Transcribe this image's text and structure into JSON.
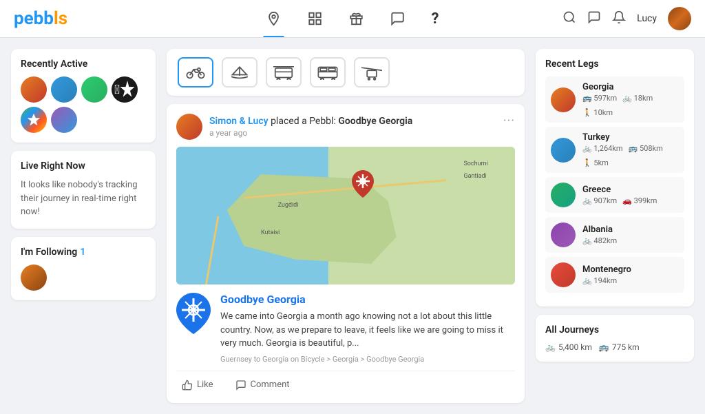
{
  "header": {
    "logo": "pebbls",
    "nav": [
      {
        "id": "location",
        "label": "Location",
        "active": true
      },
      {
        "id": "grid",
        "label": "Grid"
      },
      {
        "id": "gift",
        "label": "Gift"
      },
      {
        "id": "chat",
        "label": "Chat"
      },
      {
        "id": "help",
        "label": "Help"
      }
    ],
    "user": "Lucy"
  },
  "recently_active": {
    "title": "Recently Active",
    "users": [
      "User 1",
      "User 2",
      "User 3",
      "Apple",
      "Google Play",
      "User 6"
    ]
  },
  "live_right_now": {
    "title": "Live Right Now",
    "text": "It looks like nobody's tracking their journey in real-time right now!"
  },
  "im_following": {
    "title": "I'm Following",
    "count": "1"
  },
  "filter_bar": {
    "options": [
      "bike",
      "boat",
      "bus/tram",
      "bus",
      "cable-car"
    ]
  },
  "post": {
    "user": "Simon & Lucy",
    "action": "placed a Pebbl:",
    "title": "Goodbye Georgia",
    "time": "a year ago",
    "description": "We came into Georgia a month ago knowing not a lot about this little country. Now, as we prepare to leave, it feels like we are going to miss it very much. Georgia is beautiful, p...",
    "breadcrumb": "Guernsey to Georgia on Bicycle > Georgia > Goodbye Georgia",
    "like": "Like",
    "comment": "Comment"
  },
  "recent_legs": {
    "title": "Recent Legs",
    "items": [
      {
        "name": "Georgia",
        "stats": [
          {
            "type": "bus",
            "value": "597km"
          },
          {
            "type": "bike",
            "value": "18km"
          },
          {
            "type": "walk",
            "value": "10km"
          }
        ]
      },
      {
        "name": "Turkey",
        "stats": [
          {
            "type": "bike",
            "value": "1,264km"
          },
          {
            "type": "bus",
            "value": "508km"
          },
          {
            "type": "walk",
            "value": "5km"
          }
        ]
      },
      {
        "name": "Greece",
        "stats": [
          {
            "type": "bike",
            "value": "907km"
          },
          {
            "type": "car",
            "value": "399km"
          }
        ]
      },
      {
        "name": "Albania",
        "stats": [
          {
            "type": "bike",
            "value": "482km"
          }
        ]
      },
      {
        "name": "Montenegro",
        "stats": [
          {
            "type": "bike",
            "value": "194km"
          }
        ]
      }
    ]
  },
  "all_journeys": {
    "title": "All Journeys",
    "stats": [
      {
        "type": "bike",
        "value": "5,400 km"
      },
      {
        "type": "bus",
        "value": "775 km"
      }
    ]
  }
}
